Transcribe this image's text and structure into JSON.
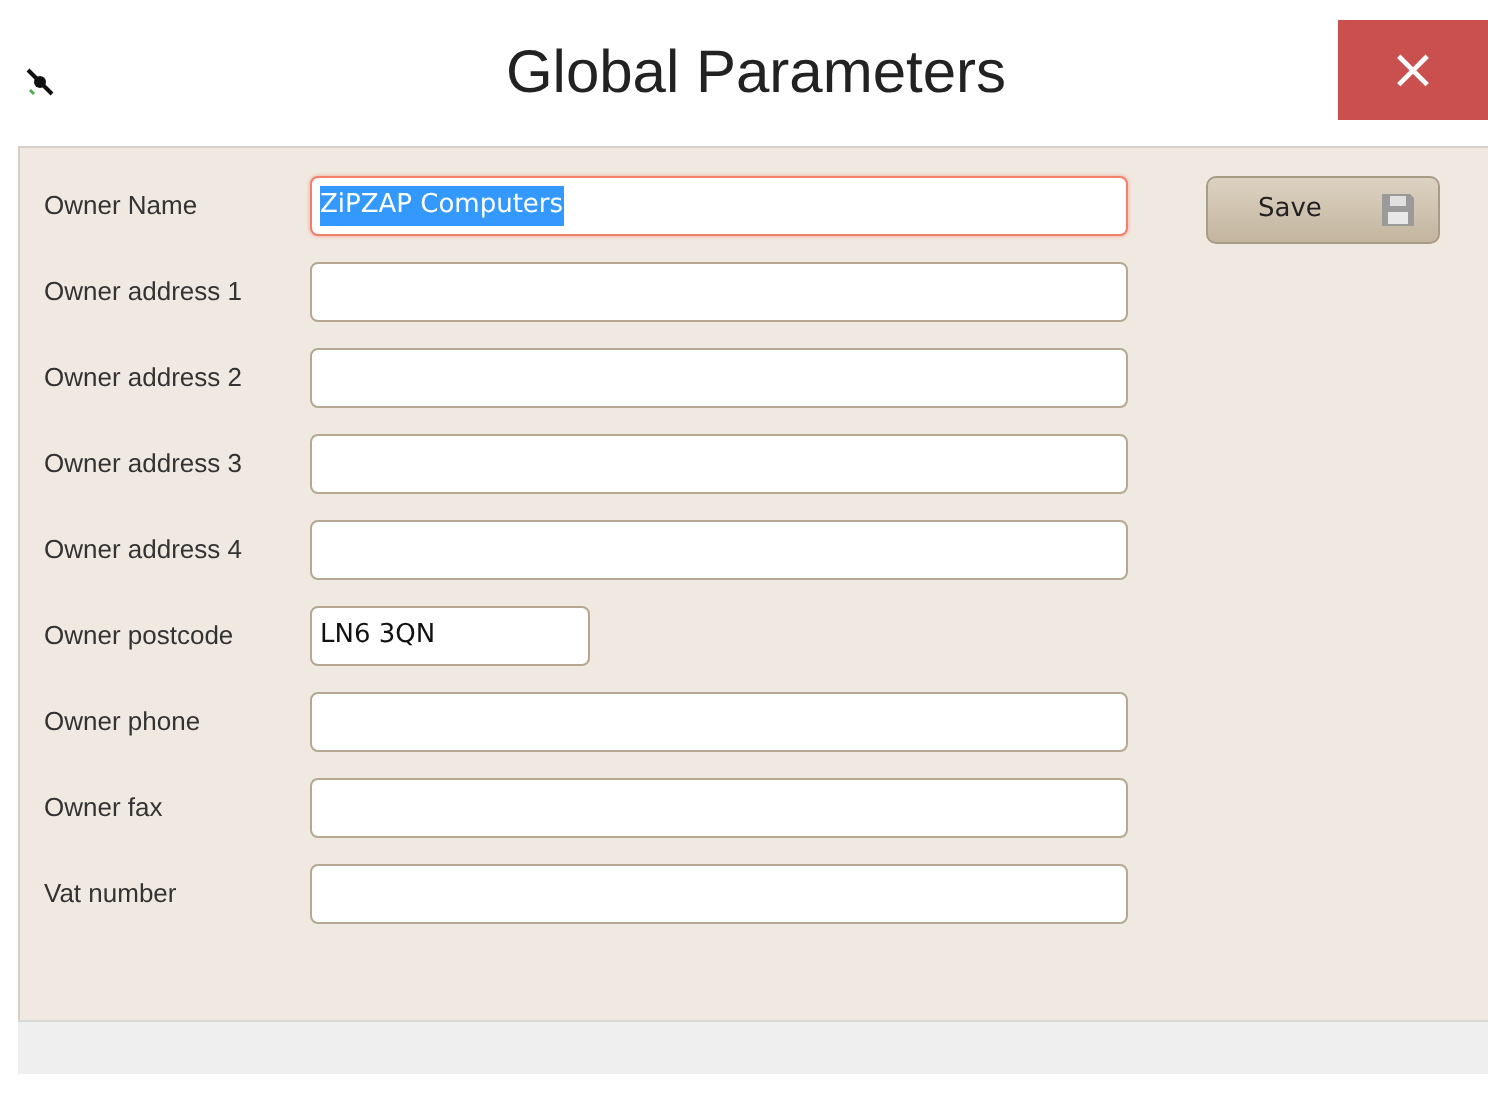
{
  "window": {
    "title": "Global Parameters",
    "close": "×"
  },
  "fields": [
    {
      "label": "Owner Name",
      "value": "ZiPZAP Computers",
      "kind": "wide",
      "focused": true
    },
    {
      "label": "Owner address 1",
      "kind": "wide",
      "focused": false
    },
    {
      "label": "Owner address 2",
      "kind": "wide",
      "focused": false
    },
    {
      "label": "Owner address 3",
      "kind": "wide",
      "focused": false
    },
    {
      "label": "Owner address 4",
      "kind": "wide",
      "focused": false
    },
    {
      "label": "Owner postcode",
      "value": "LN6 3QN",
      "kind": "short",
      "focused": false
    },
    {
      "label": "Owner phone",
      "kind": "wide",
      "focused": false
    },
    {
      "label": "Owner fax",
      "kind": "wide",
      "focused": false
    },
    {
      "label": "Vat number",
      "kind": "wide",
      "focused": false
    }
  ],
  "save_button": {
    "label": "Save"
  }
}
